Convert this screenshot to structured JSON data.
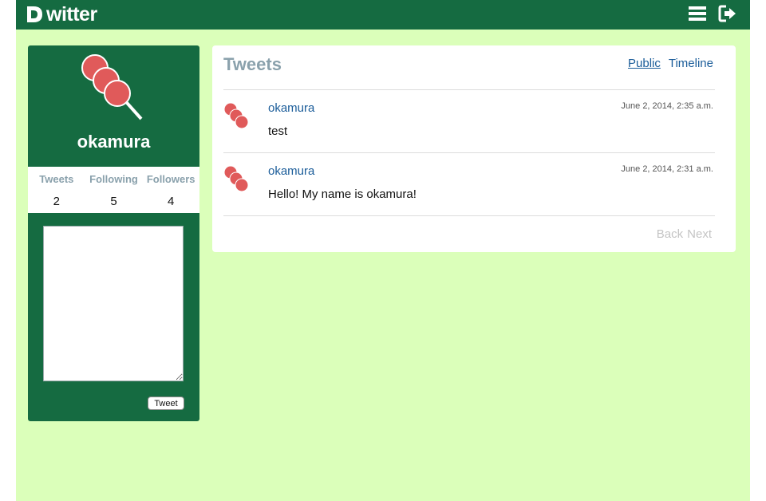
{
  "app": {
    "brand_text": "witter",
    "brand_mark": "D"
  },
  "topbar": {
    "icons": [
      "menu-icon",
      "sign-out-icon"
    ]
  },
  "profile": {
    "username": "okamura",
    "avatar_icon": "dango-icon",
    "stats": [
      {
        "label": "Tweets",
        "value": "2"
      },
      {
        "label": "Following",
        "value": "5"
      },
      {
        "label": "Followers",
        "value": "4"
      }
    ],
    "tweet_box_value": "",
    "tweet_button_label": "Tweet"
  },
  "tweets": {
    "title": "Tweets",
    "tabs": [
      {
        "label": "Public",
        "active": true
      },
      {
        "label": "Timeline",
        "active": false
      }
    ],
    "items": [
      {
        "user": "okamura",
        "time": "June 2, 2014, 2:35 a.m.",
        "text": "test"
      },
      {
        "user": "okamura",
        "time": "June 2, 2014, 2:31 a.m.",
        "text": "Hello! My name is okamura!"
      }
    ],
    "pager": {
      "back_label": "Back",
      "next_label": "Next"
    }
  },
  "colors": {
    "header_bg": "#156b41",
    "page_bg": "#dbffba",
    "link": "#1a5c99",
    "dango": "#e05a5a"
  }
}
